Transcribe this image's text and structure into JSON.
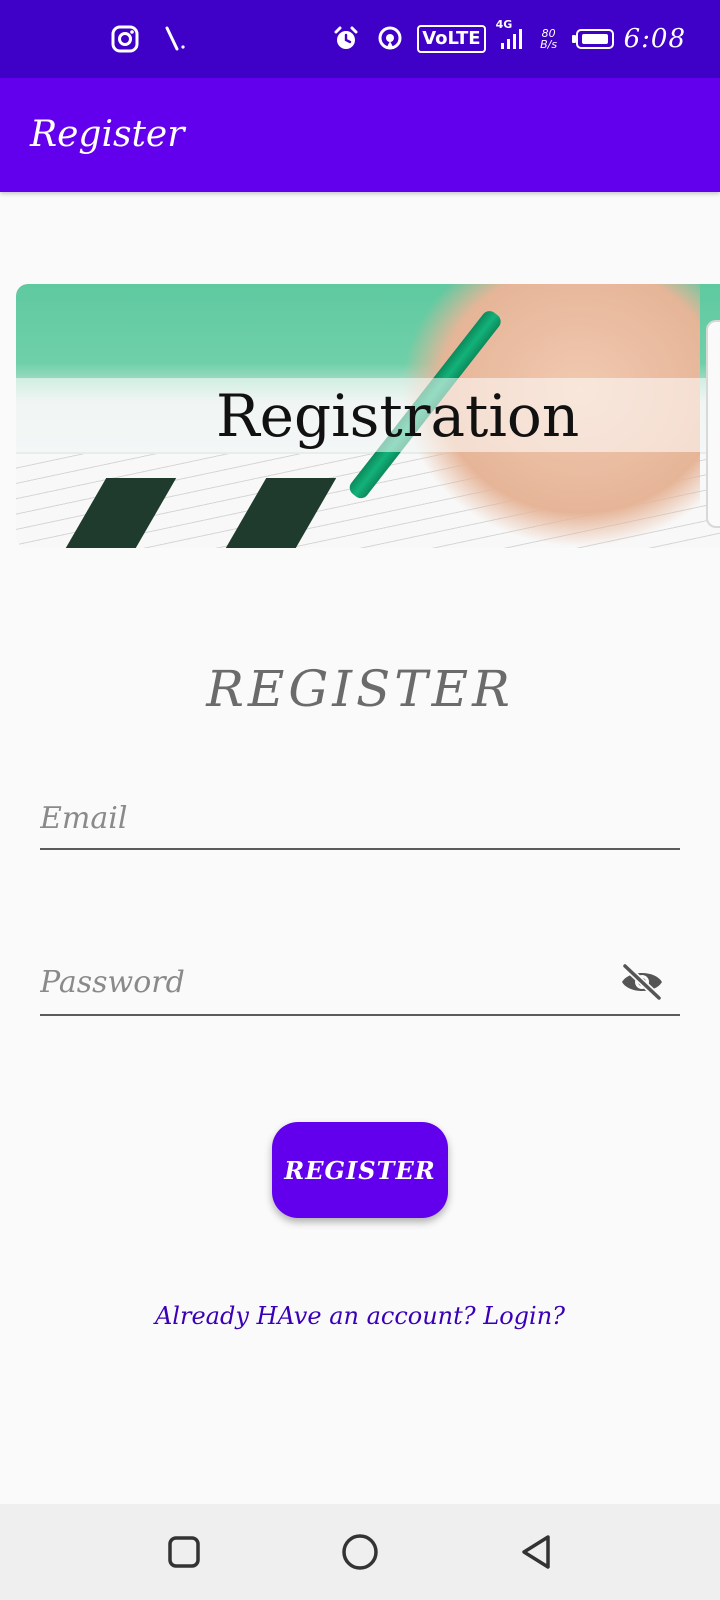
{
  "status_bar": {
    "network_badge": "VoLTE",
    "network_type": "4G",
    "speed_value": "80",
    "speed_unit": "B/s",
    "time": "6:08",
    "icons": [
      "instagram-icon",
      "pen-icon",
      "alarm-icon",
      "hotspot-icon",
      "signal-icon",
      "battery-icon"
    ]
  },
  "app_bar": {
    "title": "Register"
  },
  "banner": {
    "text": "Registration"
  },
  "form": {
    "heading": "REGISTER",
    "email_placeholder": "Email",
    "password_placeholder": "Password",
    "submit_label": "REGISTER",
    "login_link": "Already HAve an account? Login?"
  },
  "nav_bar": {
    "buttons": [
      "recents-icon",
      "home-icon",
      "back-icon"
    ]
  },
  "colors": {
    "status_bar": "#3f00c8",
    "primary": "#6200ee",
    "background": "#fafafa",
    "link": "#3a00b8"
  }
}
